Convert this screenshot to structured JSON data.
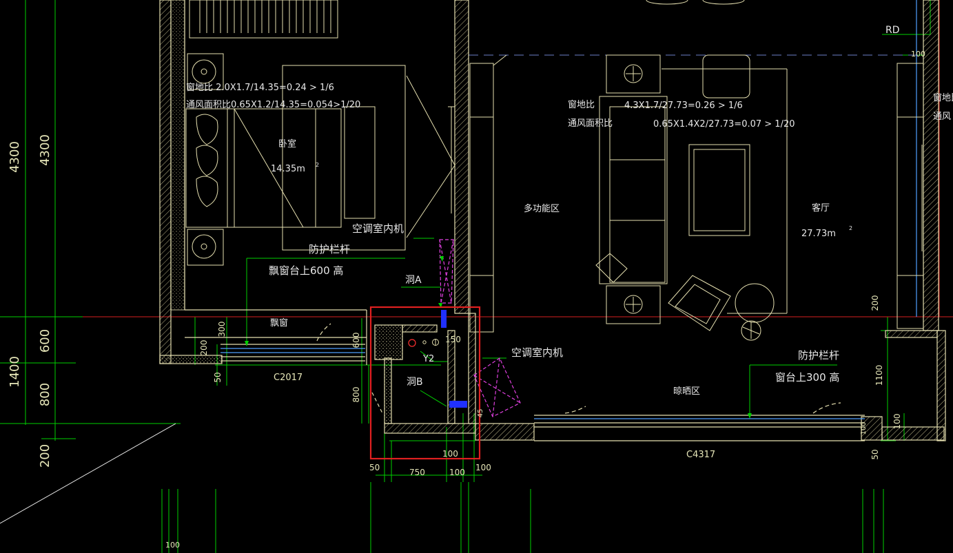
{
  "colors": {
    "background": "#000000",
    "wall": "#e6e0b0",
    "dimension": "#00e000",
    "axis": "#ff2020",
    "highlight": "#e02020",
    "duct": "#e040e0",
    "pipe": "#2040ff",
    "glass": "#4fa0ff"
  },
  "labels": {
    "bedroom_ratio1": "窗地比   2.0X1.7/14.35=0.24 >  1/6",
    "bedroom_ratio2": "通风面积比0.65X1.2/14.35=0.054>1/20",
    "bedroom_name": "卧室",
    "bedroom_area": "14.35m",
    "area_sup": "2",
    "ac_unit": "空调室内机",
    "guardrail": "防护栏杆",
    "bay_sill": "飘窗台上600  高",
    "opening_a": "洞A",
    "opening_b": "洞B",
    "bay_window": "飘窗",
    "window_c2017": "C2017",
    "pipe_y2": "Y2",
    "multi_zone": "多功能区",
    "living_ratio1": "窗地比",
    "living_ratio1_val": "4.3X1.7/27.73=0.26 >  1/6",
    "living_ratio2": "通风面积比",
    "living_ratio2_val": "0.65X1.4X2/27.73=0.07 >  1/20",
    "living_name": "客厅",
    "living_area": "27.73m",
    "ac_unit_2": "空调室内机",
    "guardrail_2": "防护栏杆",
    "sill_2": "窗台上300  高",
    "drying_zone": "晾晒区",
    "window_c4317": "C4317",
    "rd": "RD",
    "right_cut1": "窗地比",
    "right_cut2": "通风"
  },
  "dimensions": {
    "left_4300_a": "4300",
    "left_4300_b": "4300",
    "left_1400": "1400",
    "left_600": "600",
    "left_800": "800",
    "left_200": "200",
    "d300": "300",
    "d200": "200",
    "d50": "50",
    "d600": "600",
    "d800": "800",
    "d150": "150",
    "d100_box": "100",
    "b50": "50",
    "b750": "750",
    "b100a": "100",
    "b100b": "100",
    "d45": "45",
    "r200": "200",
    "r1100": "1100",
    "r100": "100",
    "r50": "50",
    "r100_top": "100",
    "bot100": "100",
    "r100b": "100"
  }
}
